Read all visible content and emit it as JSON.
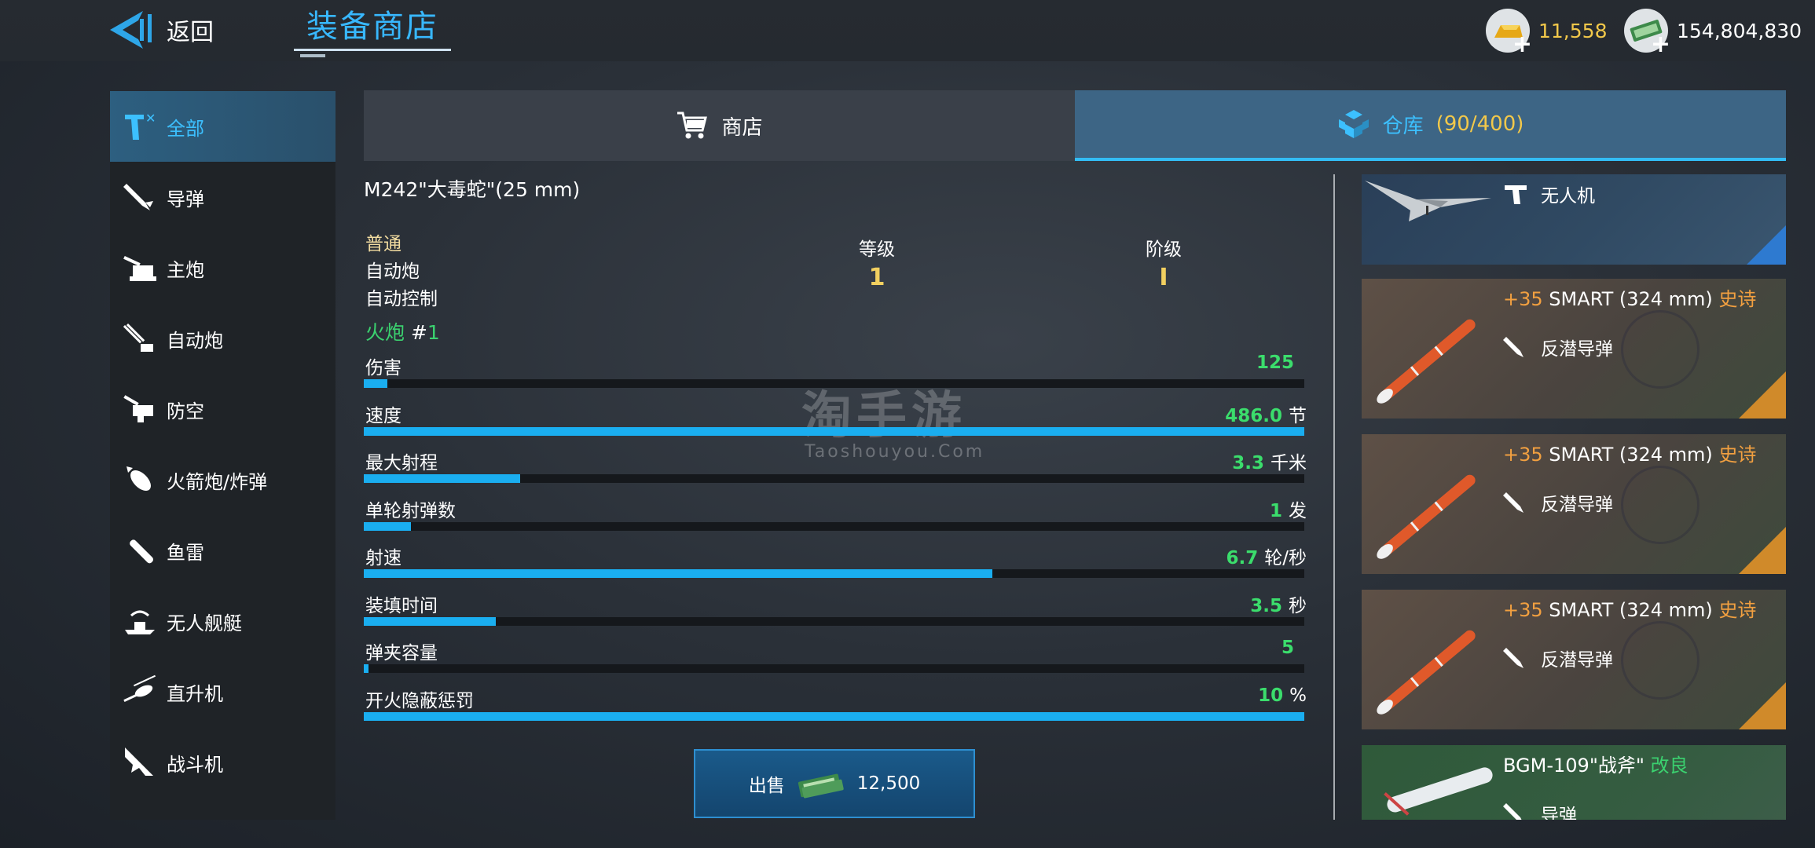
{
  "header": {
    "back_label": "返回",
    "title": "装备商店",
    "gold": "11,558",
    "cash": "154,804,830"
  },
  "sidebar": {
    "items": [
      {
        "label": "全部",
        "icon": "all-icon",
        "active": true
      },
      {
        "label": "导弹",
        "icon": "missile-icon"
      },
      {
        "label": "主炮",
        "icon": "main-gun-icon"
      },
      {
        "label": "自动炮",
        "icon": "autocannon-icon"
      },
      {
        "label": "防空",
        "icon": "anti-air-icon"
      },
      {
        "label": "火箭炮/炸弹",
        "icon": "rocket-bomb-icon"
      },
      {
        "label": "鱼雷",
        "icon": "torpedo-icon"
      },
      {
        "label": "无人舰艇",
        "icon": "unmanned-boat-icon"
      },
      {
        "label": "直升机",
        "icon": "helicopter-icon"
      },
      {
        "label": "战斗机",
        "icon": "fighter-jet-icon"
      }
    ]
  },
  "tabs": {
    "shop_label": "商店",
    "warehouse_label": "仓库",
    "warehouse_count": "(90/400)"
  },
  "detail": {
    "name": "M242\"大毒蛇\"(25 mm)",
    "rarity": "普通",
    "type": "自动炮",
    "control": "自动控制",
    "level_label": "等级",
    "level_value": "1",
    "tier_label": "阶级",
    "tier_value": "I",
    "weapon_label": "火炮",
    "weapon_hash": "#",
    "weapon_index": "1",
    "stats": [
      {
        "label": "伤害",
        "value": "125",
        "unit": "",
        "fill": 0.025
      },
      {
        "label": "速度",
        "value": "486.0",
        "unit": "节",
        "fill": 1.0
      },
      {
        "label": "最大射程",
        "value": "3.3",
        "unit": "千米",
        "fill": 0.166
      },
      {
        "label": "单轮射弹数",
        "value": "1",
        "unit": "发",
        "fill": 0.05
      },
      {
        "label": "射速",
        "value": "6.7",
        "unit": "轮/秒",
        "fill": 0.668
      },
      {
        "label": "装填时间",
        "value": "3.5",
        "unit": "秒",
        "fill": 0.14
      },
      {
        "label": "弹夹容量",
        "value": "5",
        "unit": "",
        "fill": 0.005
      },
      {
        "label": "开火隐蔽惩罚",
        "value": "10",
        "unit": "%",
        "fill": 1.0
      }
    ],
    "sell_label": "出售",
    "sell_price": "12,500"
  },
  "inventory": [
    {
      "kind": "drone",
      "name": "",
      "type": "无人机"
    },
    {
      "kind": "smart",
      "plus": "+35",
      "name": "SMART (324 mm)",
      "grade": "史诗",
      "type": "反潜导弹"
    },
    {
      "kind": "smart",
      "plus": "+35",
      "name": "SMART (324 mm)",
      "grade": "史诗",
      "type": "反潜导弹"
    },
    {
      "kind": "smart",
      "plus": "+35",
      "name": "SMART (324 mm)",
      "grade": "史诗",
      "type": "反潜导弹"
    },
    {
      "kind": "bgm",
      "name": "BGM-109\"战斧\"",
      "grade": "改良",
      "type": "导弹"
    }
  ],
  "watermark": {
    "main": "淘手游",
    "sub": "Taoshouyou.Com"
  },
  "colors": {
    "accent": "#33bdf5",
    "gold": "#f2c84a",
    "stat_green": "#3bdd6c",
    "epic": "#f2a040",
    "improved": "#3bd16f"
  }
}
